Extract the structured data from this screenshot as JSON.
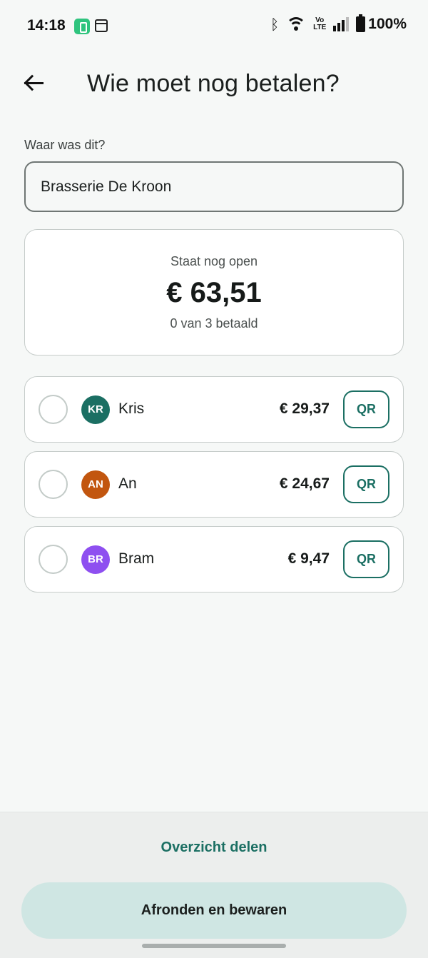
{
  "status_bar": {
    "time": "14:18",
    "battery": "100%",
    "volte": "Vo\nLTE",
    "icons": [
      "battery-saver-app-icon",
      "calendar-icon",
      "bluetooth-icon",
      "wifi-icon",
      "volte-icon",
      "signal-icon",
      "battery-icon"
    ]
  },
  "header": {
    "back_icon": "arrow-left-icon",
    "title": "Wie moet nog betalen?"
  },
  "location": {
    "label": "Waar was dit?",
    "value": "Brasserie De Kroon"
  },
  "summary": {
    "caption": "Staat nog open",
    "amount": "€ 63,51",
    "progress": "0 van 3 betaald"
  },
  "people": [
    {
      "initials": "KR",
      "name": "Kris",
      "amount": "€ 29,37",
      "qr_label": "QR",
      "avatar_color": "#1b6f63"
    },
    {
      "initials": "AN",
      "name": "An",
      "amount": "€ 24,67",
      "qr_label": "QR",
      "avatar_color": "#c2560f"
    },
    {
      "initials": "BR",
      "name": "Bram",
      "amount": "€ 9,47",
      "qr_label": "QR",
      "avatar_color": "#8e4ff0"
    }
  ],
  "actions": {
    "share_label": "Overzicht delen",
    "finish_label": "Afronden en bewaren"
  },
  "colors": {
    "accent": "#1b6f63",
    "primary_button_bg": "#cfe6e3",
    "background": "#f6f8f7"
  }
}
